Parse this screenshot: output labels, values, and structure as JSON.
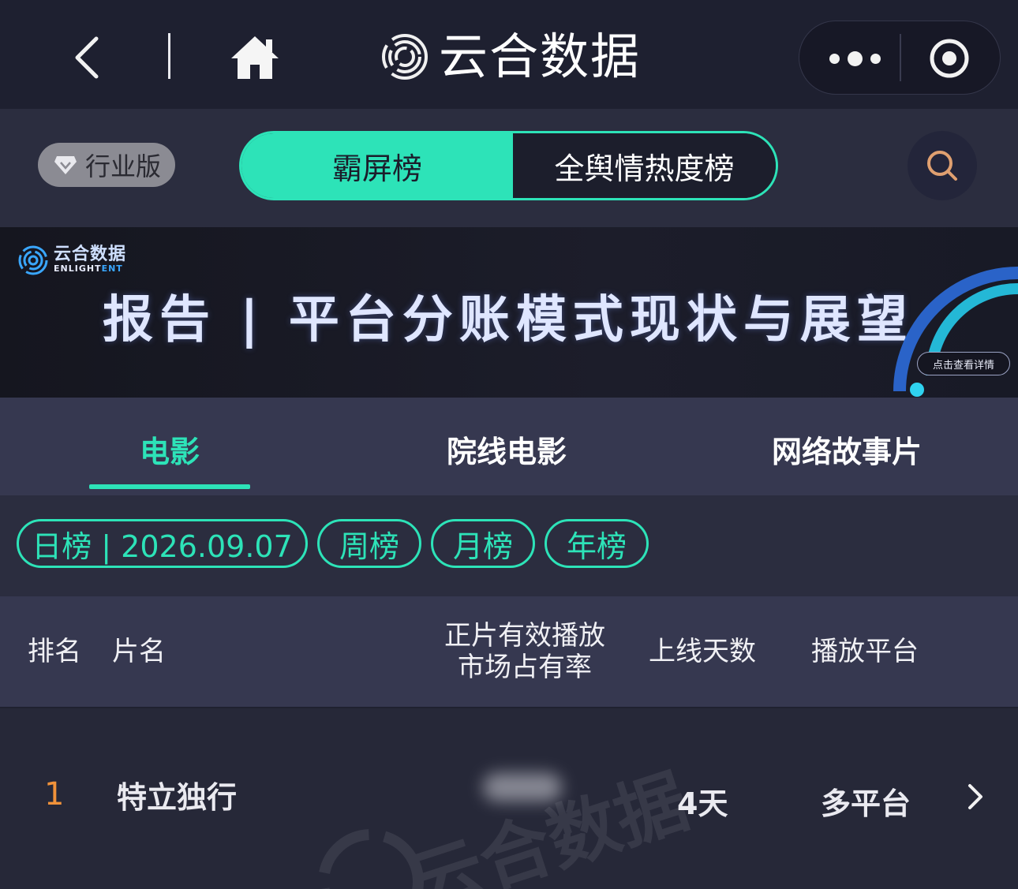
{
  "nav": {
    "app_title": "云合数据",
    "back_icon": "chevron-left-icon",
    "home_icon": "home-icon",
    "more_icon": "more-dots-icon",
    "close_icon": "target-circle-icon"
  },
  "filter_bar": {
    "industry_badge": "行业版",
    "segments": [
      "霸屏榜",
      "全舆情热度榜"
    ],
    "active_segment": "霸屏榜"
  },
  "banner": {
    "logo_cn": "云合数据",
    "logo_en_prefix": "ENLIGHT",
    "logo_en_suffix": "ENT",
    "title": "报告 | 平台分账模式现状与展望",
    "cta": "点击查看详情"
  },
  "category_tabs": {
    "items": [
      "电影",
      "院线电影",
      "网络故事片"
    ],
    "active": "电影"
  },
  "periods": {
    "items": [
      "日榜 | 2026.09.07",
      "周榜",
      "月榜",
      "年榜"
    ],
    "active": "日榜 | 2026.09.07"
  },
  "table": {
    "columns": {
      "rank": "排名",
      "title": "片名",
      "share_line1": "正片有效播放",
      "share_line2": "市场占有率",
      "days": "上线天数",
      "platform": "播放平台"
    },
    "rows": [
      {
        "rank": "1",
        "title": "特立独行",
        "share": "",
        "days": "4天",
        "platform": "多平台"
      }
    ]
  },
  "colors": {
    "accent": "#2de3b8",
    "rank_orange": "#f0923a",
    "background": "#262838"
  }
}
